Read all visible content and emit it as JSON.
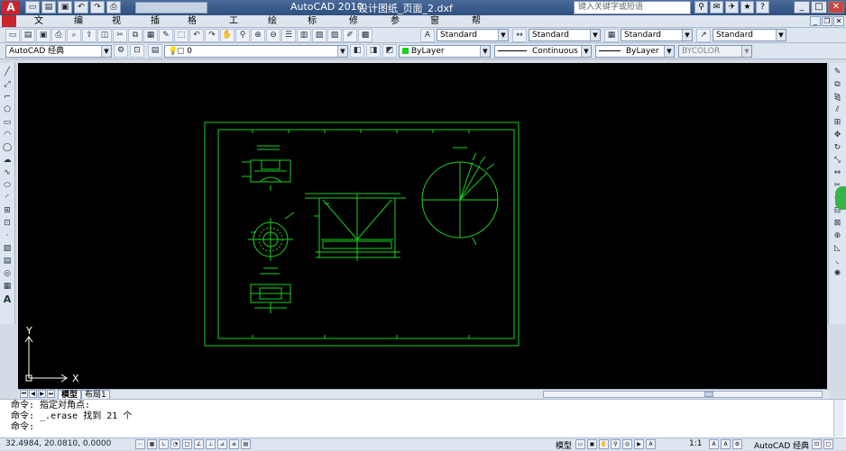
{
  "titlebar": {
    "app_logo": "A",
    "app_title": "AutoCAD 2010",
    "doc_title": "设计图纸_页面_2.dxf",
    "help_search_placeholder": "键入关键字或短语",
    "qa_icons": [
      "new-icon",
      "open-icon",
      "save-icon",
      "undo-icon",
      "redo-icon",
      "plot-icon"
    ],
    "right_icons": [
      "search-binoculars-icon",
      "subscription-icon",
      "communication-icon",
      "favorites-icon",
      "help-icon"
    ],
    "window_buttons": [
      "minimize",
      "maximize",
      "close"
    ]
  },
  "menu": {
    "items": [
      "文件(F)",
      "编辑(E)",
      "视图(V)",
      "插入(I)",
      "格式(O)",
      "工具(T)",
      "绘图(D)",
      "标注(N)",
      "修改(M)",
      "参数(P)",
      "窗口(W)",
      "帮助(H)"
    ],
    "spacing": [
      38,
      82,
      124,
      167,
      208,
      254,
      297,
      341,
      387,
      433,
      477,
      523
    ]
  },
  "toolbar1": {
    "styles": [
      {
        "name": "text-style",
        "value": "Standard"
      },
      {
        "name": "dim-style",
        "value": "Standard"
      },
      {
        "name": "table-style",
        "value": "Standard"
      },
      {
        "name": "multileader-style",
        "value": "Standard"
      }
    ]
  },
  "toolbar2": {
    "workspace": "AutoCAD 经典",
    "layer": "0",
    "color": "ByLayer",
    "linetype": "Continuous",
    "lineweight": "ByLayer",
    "plotstyle": "BYCOLOR"
  },
  "left_tools": [
    "line-icon",
    "construction-line-icon",
    "polyline-icon",
    "polygon-icon",
    "rectangle-icon",
    "arc-icon",
    "circle-icon",
    "revision-cloud-icon",
    "spline-icon",
    "ellipse-icon",
    "ellipse-arc-icon",
    "insert-block-icon",
    "make-block-icon",
    "point-icon",
    "hatch-icon",
    "gradient-icon",
    "region-icon",
    "table-icon",
    "mtext-icon"
  ],
  "right_tools": [
    "erase-icon",
    "copy-icon",
    "mirror-icon",
    "offset-icon",
    "array-icon",
    "move-icon",
    "rotate-icon",
    "scale-icon",
    "stretch-icon",
    "trim-icon",
    "extend-icon",
    "break-point-icon",
    "break-icon",
    "join-icon",
    "chamfer-icon",
    "fillet-icon",
    "explode-icon"
  ],
  "ucs": {
    "x_label": "X",
    "y_label": "Y"
  },
  "layout_tabs": {
    "model": "模型",
    "layout1": "布局1"
  },
  "command_lines": [
    "命令: 指定对角点:",
    "命令: _.erase 找到 21 个",
    "命令:"
  ],
  "status": {
    "coordinates": "32.4984, 20.0810, 0.0000",
    "model_label": "模型",
    "scale": "1:1",
    "workspace": "AutoCAD 经典"
  },
  "colors": {
    "drawing_green": "#19d21e",
    "canvas": "#000000",
    "ui_bg": "#dde5ef"
  }
}
